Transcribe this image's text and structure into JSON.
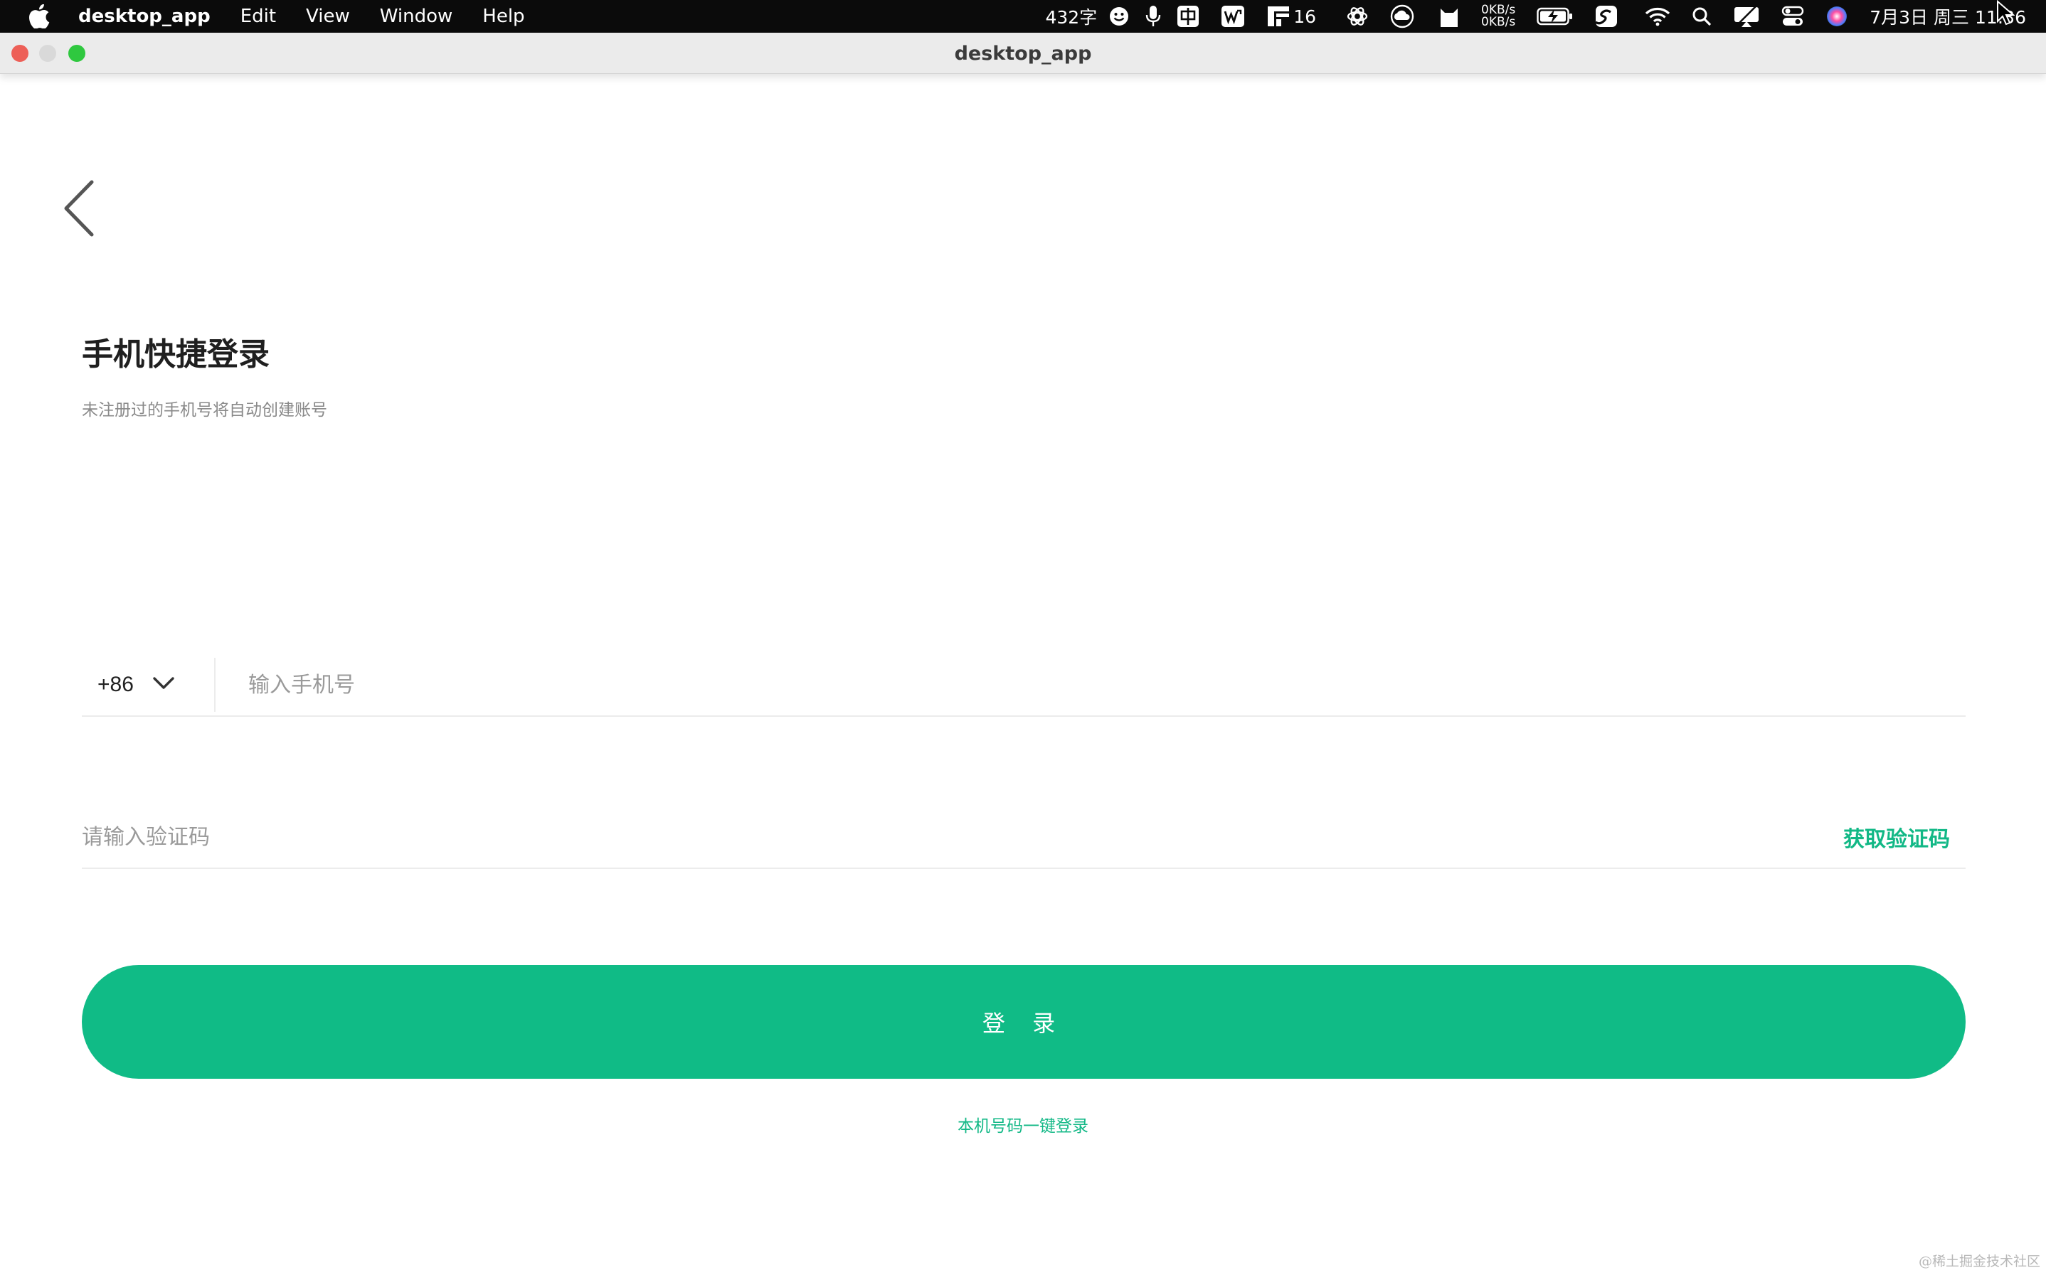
{
  "menubar": {
    "app_name": "desktop_app",
    "menus": [
      "Edit",
      "View",
      "Window",
      "Help"
    ],
    "word_count": "432字",
    "ime_label": "中",
    "wps_count": "16",
    "net_up": "0KB/s",
    "net_down": "0KB/s",
    "clock": "7月3日 周三  11:36"
  },
  "window": {
    "title": "desktop_app"
  },
  "page": {
    "title": "手机快捷登录",
    "subtitle": "未注册过的手机号将自动创建账号"
  },
  "phone": {
    "country_code": "+86",
    "placeholder": "输入手机号",
    "value": ""
  },
  "verify": {
    "placeholder": "请输入验证码",
    "value": "",
    "get_code_label": "获取验证码"
  },
  "login": {
    "button_label": "登 录",
    "one_tap_label": "本机号码一键登录"
  },
  "watermark": "@稀土掘金技术社区",
  "colors": {
    "accent": "#10bb86",
    "menubar_bg": "#0b0b0b",
    "titlebar_bg": "#ebebeb"
  }
}
